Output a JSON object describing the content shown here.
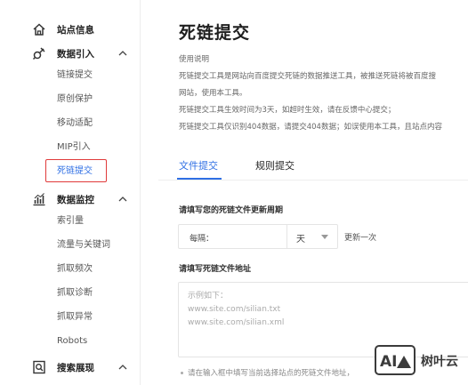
{
  "sidebar": {
    "groups": [
      {
        "label": "站点信息",
        "icon": "home-icon"
      },
      {
        "label": "数据引入",
        "icon": "plug-icon",
        "expanded": true,
        "items": [
          "链接提交",
          "原创保护",
          "移动适配",
          "MIP引入",
          "死链提交"
        ]
      },
      {
        "label": "数据监控",
        "icon": "bar-chart-icon",
        "expanded": true,
        "items": [
          "索引量",
          "流量与关键词",
          "抓取频次",
          "抓取诊断",
          "抓取异常",
          "Robots"
        ]
      },
      {
        "label": "搜索展现",
        "icon": "search-doc-icon",
        "expanded": true
      }
    ],
    "active_item": "死链提交",
    "highlight_color": "#e03a3a",
    "active_color": "#2f6fe4"
  },
  "main": {
    "title": "死链提交",
    "usage": {
      "title": "使用说明",
      "lines": [
        "死链提交工具是网站向百度提交死链的数据推送工具，被推送死链将被百度搜",
        "网站，使用本工具。",
        "死链提交工具生效时间为3天，如超时生效，请在反馈中心提交；",
        "死链提交工具仅识别404数据，请提交404数据；如误使用本工具，且站点内容"
      ]
    },
    "tabs": [
      {
        "label": "文件提交",
        "active": true
      },
      {
        "label": "规则提交",
        "active": false
      }
    ],
    "period": {
      "label": "请填写您的死链文件更新周期",
      "select_text": "每隔：",
      "unit": "天",
      "suffix": "更新一次"
    },
    "address": {
      "label": "请填写死链文件地址",
      "placeholder_lines": [
        "示例如下：",
        "www.site.com/silian.txt",
        "www.site.com/silian.xml"
      ]
    },
    "hint": "请在输入框中填写当前选择站点的死链文件地址，"
  },
  "watermark": {
    "logo_text": "AI",
    "text": "树叶云"
  }
}
